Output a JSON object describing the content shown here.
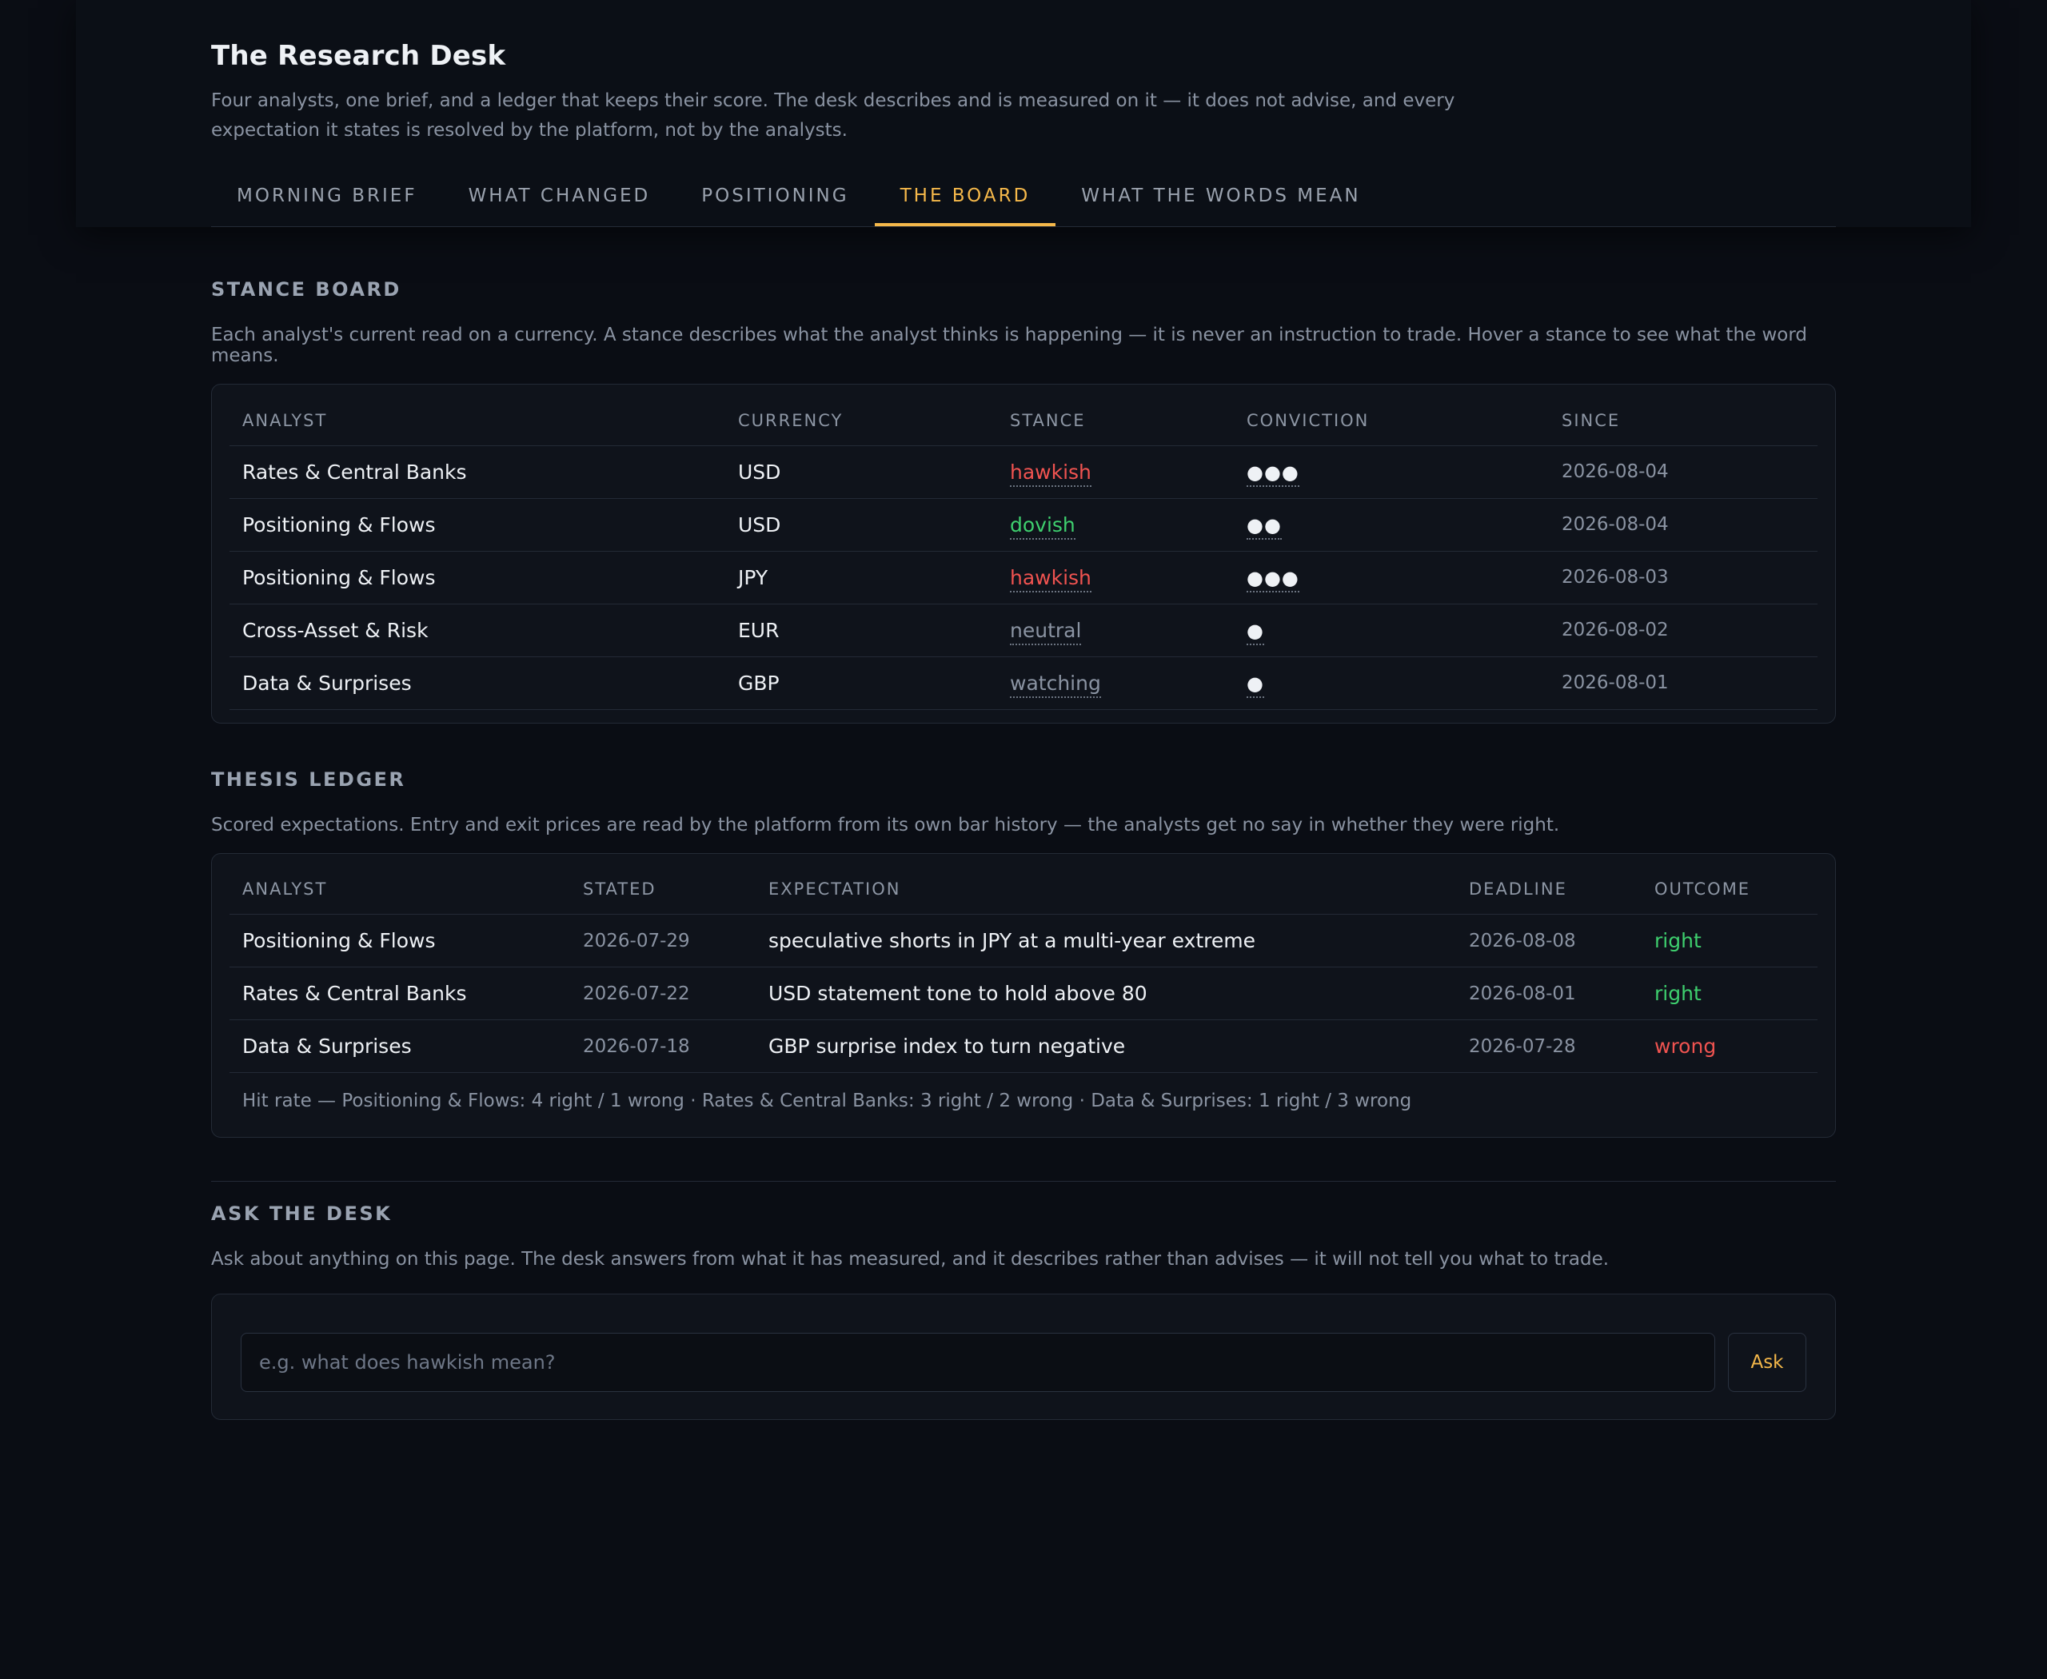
{
  "app": {
    "title": "The Research Desk",
    "subtitle": "Four analysts, one brief, and a ledger that keeps their score. The desk describes and is measured on it — it does not advise, and every expectation it states is resolved by the platform, not by the analysts."
  },
  "tabs": [
    {
      "label": "MORNING BRIEF",
      "active": false
    },
    {
      "label": "WHAT CHANGED",
      "active": false
    },
    {
      "label": "POSITIONING",
      "active": false
    },
    {
      "label": "THE BOARD",
      "active": true
    },
    {
      "label": "WHAT THE WORDS MEAN",
      "active": false
    }
  ],
  "stance_board": {
    "title": "STANCE BOARD",
    "description": "Each analyst's current read on a currency. A stance describes what the analyst thinks is happening — it is never an instruction to trade. Hover a stance to see what the word means.",
    "columns": [
      "ANALYST",
      "CURRENCY",
      "STANCE",
      "CONVICTION",
      "SINCE"
    ],
    "rows": [
      {
        "analyst": "Rates & Central Banks",
        "currency": "USD",
        "stance": "hawkish",
        "conviction": "●●●",
        "since": "2026-08-04"
      },
      {
        "analyst": "Positioning & Flows",
        "currency": "USD",
        "stance": "dovish",
        "conviction": "●●",
        "since": "2026-08-04"
      },
      {
        "analyst": "Positioning & Flows",
        "currency": "JPY",
        "stance": "hawkish",
        "conviction": "●●●",
        "since": "2026-08-03"
      },
      {
        "analyst": "Cross-Asset & Risk",
        "currency": "EUR",
        "stance": "neutral",
        "conviction": "●",
        "since": "2026-08-02"
      },
      {
        "analyst": "Data & Surprises",
        "currency": "GBP",
        "stance": "watching",
        "conviction": "●",
        "since": "2026-08-01"
      }
    ]
  },
  "thesis_ledger": {
    "title": "THESIS LEDGER",
    "description": "Scored expectations. Entry and exit prices are read by the platform from its own bar history — the analysts get no say in whether they were right.",
    "columns": [
      "ANALYST",
      "STATED",
      "EXPECTATION",
      "DEADLINE",
      "OUTCOME"
    ],
    "rows": [
      {
        "analyst": "Positioning & Flows",
        "stated": "2026-07-29",
        "expectation": "speculative shorts in JPY at a multi-year extreme",
        "deadline": "2026-08-08",
        "outcome": "right"
      },
      {
        "analyst": "Rates & Central Banks",
        "stated": "2026-07-22",
        "expectation": "USD statement tone to hold above 80",
        "deadline": "2026-08-01",
        "outcome": "right"
      },
      {
        "analyst": "Data & Surprises",
        "stated": "2026-07-18",
        "expectation": "GBP surprise index to turn negative",
        "deadline": "2026-07-28",
        "outcome": "wrong"
      }
    ],
    "hit_rate": "Hit rate — Positioning & Flows: 4 right / 1 wrong · Rates & Central Banks: 3 right / 2 wrong · Data & Surprises: 1 right / 3 wrong"
  },
  "ask": {
    "title": "ASK THE DESK",
    "description": "Ask about anything on this page. The desk answers from what it has measured, and it describes rather than advises — it will not tell you what to trade.",
    "placeholder": "e.g. what does hawkish mean?",
    "button_label": "Ask"
  },
  "colors": {
    "accent": "#f5b84a",
    "hawkish": "#ef5350",
    "dovish": "#3ecf6e",
    "neutral": "#8a93a2",
    "right": "#3ecf6e",
    "wrong": "#ef5350"
  }
}
